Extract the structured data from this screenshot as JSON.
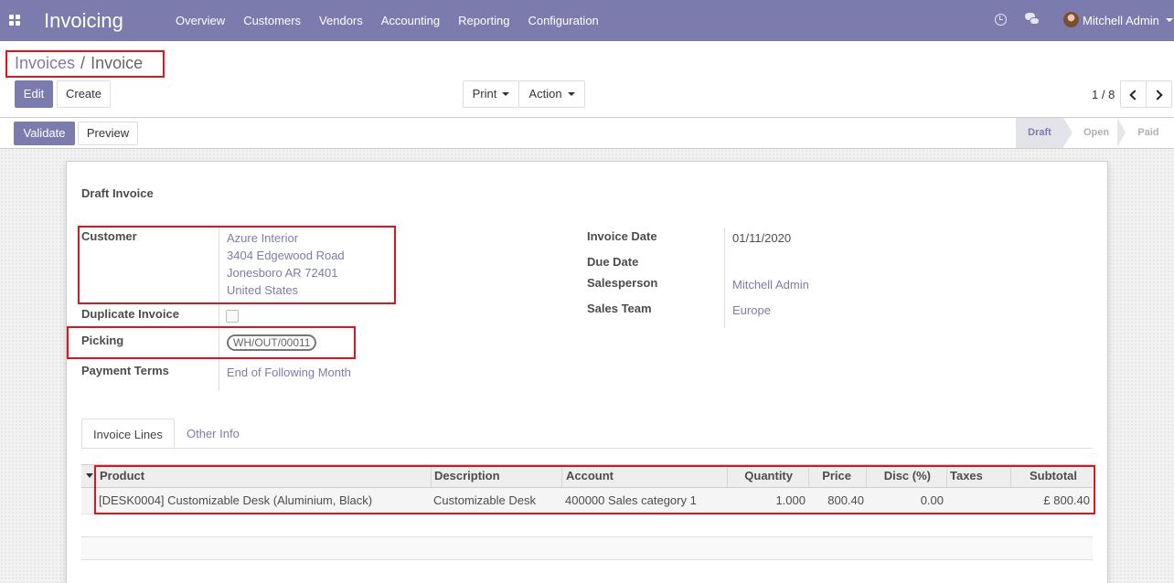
{
  "app": {
    "name": "Invoicing"
  },
  "menu": [
    "Overview",
    "Customers",
    "Vendors",
    "Accounting",
    "Reporting",
    "Configuration"
  ],
  "user": {
    "name": "Mitchell Admin"
  },
  "icons": {
    "apps": "apps-grid-icon",
    "activity": "clock-icon",
    "messaging": "chat-icon"
  },
  "breadcrumb": {
    "parent": "Invoices",
    "separator": "/",
    "current": "Invoice"
  },
  "buttons": {
    "edit": "Edit",
    "create": "Create",
    "print": "Print",
    "action": "Action",
    "validate": "Validate",
    "preview": "Preview"
  },
  "pager": {
    "value": "1 / 8"
  },
  "stages": [
    "Draft",
    "Open",
    "Paid"
  ],
  "active_stage": "Draft",
  "form": {
    "title": "Draft Invoice",
    "customer_label": "Customer",
    "customer": {
      "name": "Azure Interior",
      "street": "3404 Edgewood Road",
      "city": "Jonesboro AR 72401",
      "country": "United States"
    },
    "duplicate_label": "Duplicate Invoice",
    "picking_label": "Picking",
    "picking_value": "WH/OUT/00011",
    "payment_terms_label": "Payment Terms",
    "payment_terms_value": "End of Following Month",
    "invoice_date_label": "Invoice Date",
    "invoice_date_value": "01/11/2020",
    "due_date_label": "Due Date",
    "salesperson_label": "Salesperson",
    "salesperson_value": "Mitchell Admin",
    "sales_team_label": "Sales Team",
    "sales_team_value": "Europe"
  },
  "tabs": [
    "Invoice Lines",
    "Other Info"
  ],
  "table": {
    "columns": [
      "Product",
      "Description",
      "Account",
      "Quantity",
      "Price",
      "Disc (%)",
      "Taxes",
      "Subtotal"
    ],
    "rows": [
      {
        "product": "[DESK0004] Customizable Desk (Aluminium, Black)",
        "description": "Customizable Desk",
        "account": "400000 Sales category 1",
        "quantity": "1.000",
        "price": "800.40",
        "discount": "0.00",
        "taxes": "",
        "subtotal": "£ 800.40"
      }
    ]
  },
  "colors": {
    "brand": "#7c7bad",
    "highlight": "#e0141e"
  }
}
